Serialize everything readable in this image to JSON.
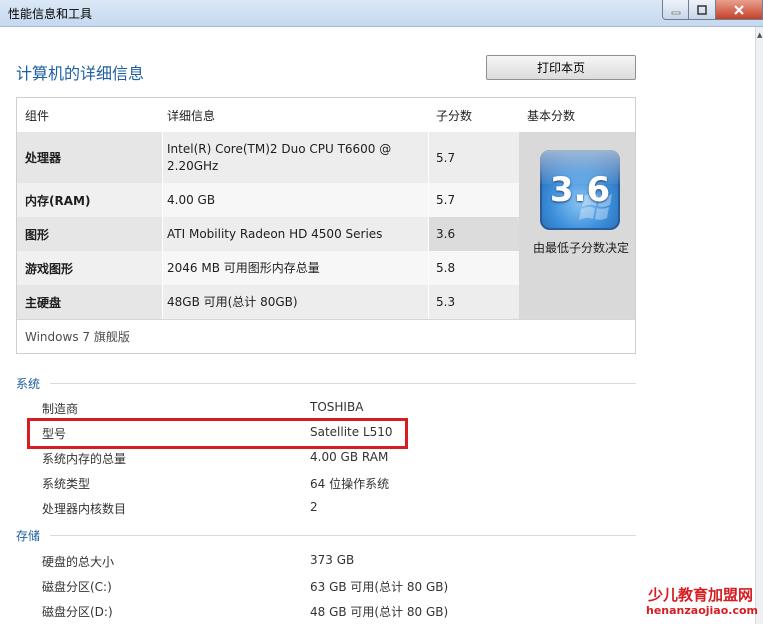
{
  "window": {
    "title": "性能信息和工具"
  },
  "header": {
    "title": "计算机的详细信息",
    "print_label": "打印本页"
  },
  "table": {
    "columns": [
      "组件",
      "详细信息",
      "子分数",
      "基本分数"
    ],
    "rows": [
      {
        "component": "处理器",
        "detail": "Intel(R) Core(TM)2 Duo CPU T6600 @ 2.20GHz",
        "subscore": "5.7"
      },
      {
        "component": "内存(RAM)",
        "detail": "4.00 GB",
        "subscore": "5.7"
      },
      {
        "component": "图形",
        "detail": "ATI Mobility Radeon HD 4500 Series",
        "subscore": "3.6"
      },
      {
        "component": "游戏图形",
        "detail": "2046 MB 可用图形内存总量",
        "subscore": "5.8"
      },
      {
        "component": "主硬盘",
        "detail": "48GB 可用(总计 80GB)",
        "subscore": "5.3"
      }
    ],
    "base_score": "3.6",
    "base_note": "由最低子分数决定",
    "edition": "Windows 7 旗舰版"
  },
  "system": {
    "title": "系统",
    "items": [
      {
        "label": "制造商",
        "value": "TOSHIBA"
      },
      {
        "label": "型号",
        "value": "Satellite L510"
      },
      {
        "label": "系统内存的总量",
        "value": "4.00 GB RAM"
      },
      {
        "label": "系统类型",
        "value": "64 位操作系统"
      },
      {
        "label": "处理器内核数目",
        "value": "2"
      }
    ]
  },
  "storage": {
    "title": "存储",
    "items": [
      {
        "label": "硬盘的总大小",
        "value": "373 GB"
      },
      {
        "label": "磁盘分区(C:)",
        "value": "63 GB 可用(总计 80 GB)"
      },
      {
        "label": "磁盘分区(D:)",
        "value": "48 GB 可用(总计 80 GB)"
      }
    ]
  },
  "watermark": {
    "line1": "少儿教育加盟网",
    "line2": "henanzaojiao.com"
  },
  "icons": {
    "minimize": "minimize-icon",
    "maximize": "maximize-icon",
    "close": "close-icon",
    "score_badge": "windows-score-badge-icon",
    "scroll_up": "scroll-up-arrow-icon"
  },
  "colors": {
    "accent": "#1e5fa3",
    "highlight": "#d51d22",
    "close_button": "#c4412a"
  }
}
